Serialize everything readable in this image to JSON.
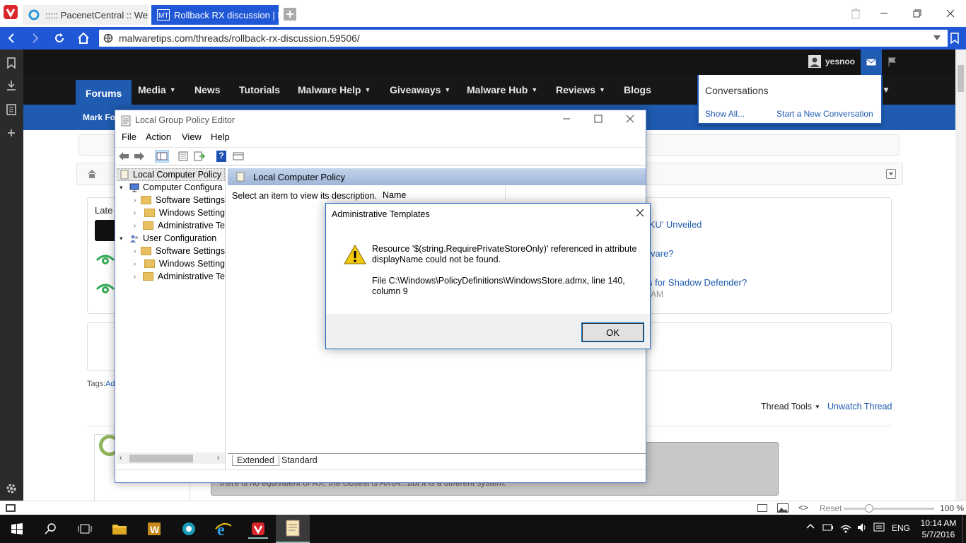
{
  "browser": {
    "tabs": [
      {
        "label": "::::: PacenetCentral :: Welco",
        "active": false
      },
      {
        "label": "Rollback RX discussion | Ma",
        "active": true
      }
    ],
    "url": "malwaretips.com/threads/rollback-rx-discussion.59506/",
    "status": {
      "reset": "Reset",
      "zoom": "100 %"
    }
  },
  "site": {
    "username": "yesnoo",
    "nav": [
      "Forums",
      "Media",
      "News",
      "Tutorials",
      "Malware Help",
      "Giveaways",
      "Malware Hub",
      "Reviews",
      "Blogs"
    ],
    "subnav_fragment": "Mark Fo",
    "conversations": {
      "title": "Conversations",
      "show_all": "Show All...",
      "start_new": "Start a New Conversation"
    },
    "latest_fragment": "Late",
    "sidebar_links": [
      "AKU' Unveiled",
      "vare?",
      "s for Shadow Defender?"
    ],
    "sidebar_time": "AM",
    "tags_fragment": "Tags:",
    "tags_link_fragment": "Ad",
    "thread_tools": "Thread Tools",
    "unwatch": "Unwatch Thread",
    "post_fragment": "there is no equivalent of RX, the closest is AX64...but it is a different system."
  },
  "gpe": {
    "title": "Local Group Policy Editor",
    "menu": [
      "File",
      "Action",
      "View",
      "Help"
    ],
    "tree": [
      {
        "label": "Local Computer Policy",
        "level": 0,
        "selected": true
      },
      {
        "label": "Computer Configura",
        "level": 1
      },
      {
        "label": "Software Settings",
        "level": 2
      },
      {
        "label": "Windows Setting",
        "level": 2
      },
      {
        "label": "Administrative Te",
        "level": 2
      },
      {
        "label": "User Configuration",
        "level": 1
      },
      {
        "label": "Software Settings",
        "level": 2
      },
      {
        "label": "Windows Setting",
        "level": 2
      },
      {
        "label": "Administrative Te",
        "level": 2
      }
    ],
    "header": "Local Computer Policy",
    "description": "Select an item to view its description.",
    "name_col": "Name",
    "tabs": [
      "Extended",
      "Standard"
    ]
  },
  "dialog": {
    "title": "Administrative Templates",
    "message1": "Resource '$(string.RequirePrivateStoreOnly)' referenced in attribute displayName could not be found.",
    "message2": "File C:\\Windows\\PolicyDefinitions\\WindowsStore.admx, line 140, column 9",
    "ok": "OK"
  },
  "taskbar": {
    "lang": "ENG",
    "time": "10:14 AM",
    "date": "5/7/2016"
  },
  "colors": {
    "accent": "#1f57d6",
    "site_blue": "#1e5bb1",
    "vivaldi_red": "#d9262d"
  }
}
